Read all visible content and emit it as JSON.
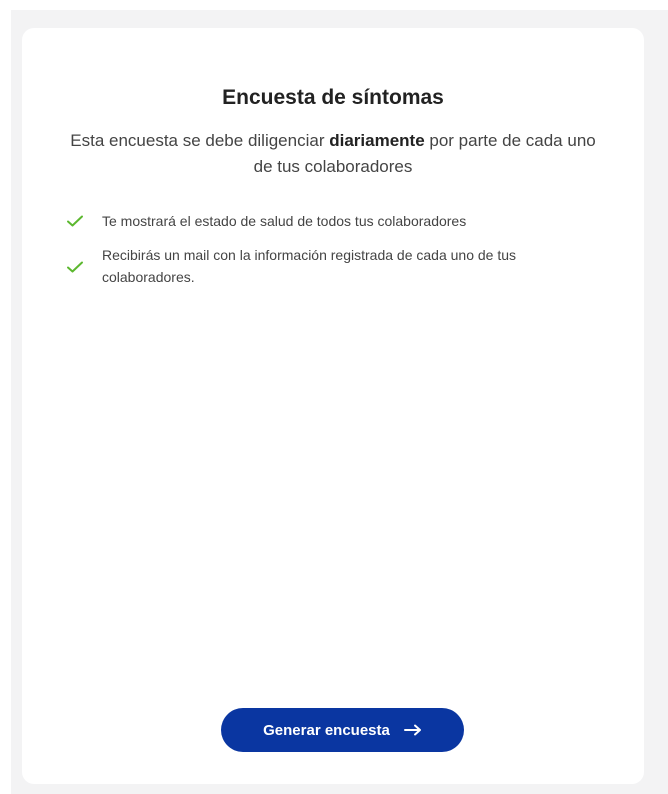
{
  "survey": {
    "title": "Encuesta de síntomas",
    "subtitle_before": "Esta encuesta se debe diligenciar ",
    "subtitle_bold": "diariamente",
    "subtitle_after": " por parte de cada uno de tus colaboradores",
    "features": [
      {
        "text": "Te mostrará el estado de salud de todos tus colaboradores",
        "icon": "check-icon"
      },
      {
        "text": "Recibirás un mail con la información registrada de cada uno de tus colaboradores.",
        "icon": "check-icon"
      }
    ],
    "cta_label": "Generar encuesta",
    "cta_icon": "arrow-right-icon"
  },
  "colors": {
    "accent": "#0a36a1",
    "check": "#5cb82f",
    "background": "#f3f3f4",
    "card": "#ffffff"
  }
}
